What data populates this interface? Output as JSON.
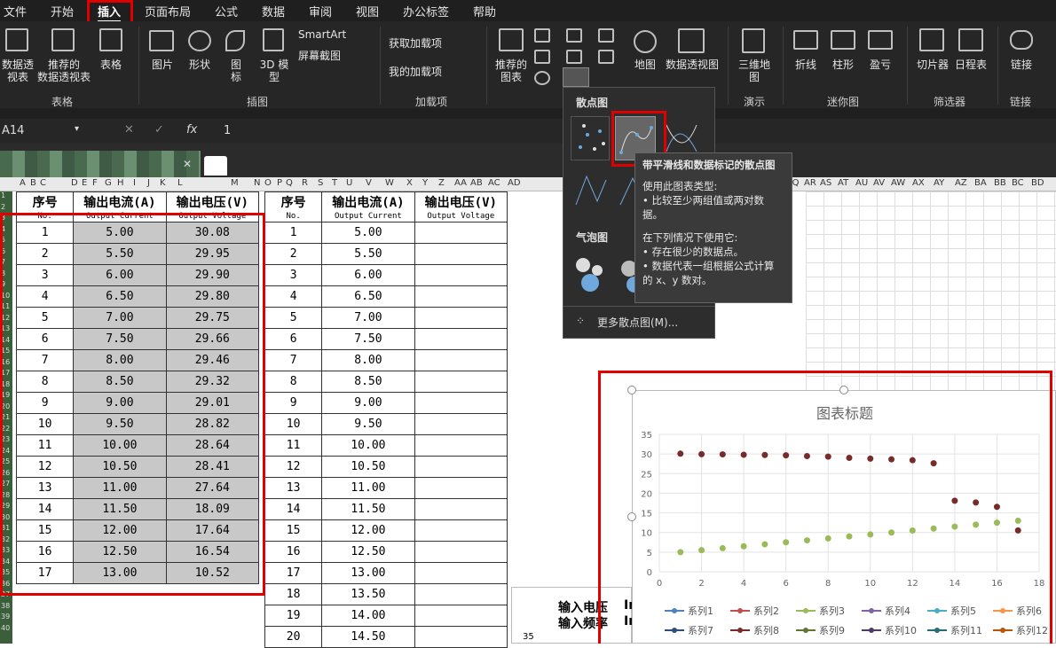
{
  "menu": {
    "items": [
      "文件",
      "开始",
      "插入",
      "页面布局",
      "公式",
      "数据",
      "审阅",
      "视图",
      "办公标签",
      "帮助"
    ],
    "active": "插入"
  },
  "ribbon": {
    "pivot": "数据透\n视表",
    "rec_pivot": "推荐的\n数据透视表",
    "table": "表格",
    "group_table": "表格",
    "picture": "图片",
    "shapes": "形状",
    "icons": "图\n标",
    "model3d": "3D 模\n型",
    "smartart": "SmartArt",
    "screenshot": "屏幕截图",
    "group_illus": "插图",
    "get_addins": "获取加载项",
    "my_addins": "我的加载项",
    "group_addins": "加载项",
    "rec_charts": "推荐的\n图表",
    "map": "地图",
    "pivot_chart": "数据透视图",
    "map3d": "三维地\n图",
    "group_tour": "演示",
    "spark_line": "折线",
    "spark_col": "柱形",
    "spark_wl": "盈亏",
    "group_spark": "迷你图",
    "slicer": "切片器",
    "timeline": "日程表",
    "group_filter": "筛选器",
    "link": "链接",
    "group_links": "链接"
  },
  "formula_bar": {
    "name_box": "A14",
    "fx": "fx",
    "value": "1"
  },
  "columns": [
    "A",
    "B",
    "C",
    "D",
    "E",
    "F",
    "G",
    "H",
    "I",
    "J",
    "K",
    "L",
    "M",
    "N",
    "O",
    "P",
    "Q",
    "R",
    "S",
    "T",
    "U",
    "V",
    "W",
    "X",
    "Y",
    "Z",
    "AA",
    "AB",
    "AC",
    "AD",
    "AQ",
    "AR",
    "AS",
    "AT",
    "AU",
    "AV",
    "AW",
    "AX",
    "AY",
    "AZ",
    "BA",
    "BB",
    "BC",
    "BD"
  ],
  "rows": [
    "1",
    "2",
    "3",
    "4",
    "5",
    "6",
    "7",
    "8",
    "9",
    "10",
    "11",
    "12",
    "13",
    "14",
    "15",
    "16",
    "17",
    "18",
    "19",
    "20",
    "21",
    "22",
    "23",
    "24",
    "25",
    "26",
    "27",
    "28",
    "29",
    "30",
    "31",
    "32",
    "33",
    "34",
    "35",
    "36",
    "37",
    "38",
    "39",
    "40"
  ],
  "table1": {
    "headers": [
      "序号",
      "输出电流(A)",
      "输出电压(V)"
    ],
    "subheaders": [
      "No.",
      "Output Current",
      "Output Voltage"
    ],
    "rows": [
      [
        "1",
        "5.00",
        "30.08"
      ],
      [
        "2",
        "5.50",
        "29.95"
      ],
      [
        "3",
        "6.00",
        "29.90"
      ],
      [
        "4",
        "6.50",
        "29.80"
      ],
      [
        "5",
        "7.00",
        "29.75"
      ],
      [
        "6",
        "7.50",
        "29.66"
      ],
      [
        "7",
        "8.00",
        "29.46"
      ],
      [
        "8",
        "8.50",
        "29.32"
      ],
      [
        "9",
        "9.00",
        "29.01"
      ],
      [
        "10",
        "9.50",
        "28.82"
      ],
      [
        "11",
        "10.00",
        "28.64"
      ],
      [
        "12",
        "10.50",
        "28.41"
      ],
      [
        "13",
        "11.00",
        "27.64"
      ],
      [
        "14",
        "11.50",
        "18.09"
      ],
      [
        "15",
        "12.00",
        "17.64"
      ],
      [
        "16",
        "12.50",
        "16.54"
      ],
      [
        "17",
        "13.00",
        "10.52"
      ]
    ]
  },
  "table2": {
    "headers": [
      "序号",
      "输出电流(A)",
      "输出电压(V)"
    ],
    "subheaders": [
      "No.",
      "Output Current",
      "Output Voltage"
    ],
    "rows": [
      [
        "1",
        "5.00"
      ],
      [
        "2",
        "5.50"
      ],
      [
        "3",
        "6.00"
      ],
      [
        "4",
        "6.50"
      ],
      [
        "5",
        "7.00"
      ],
      [
        "6",
        "7.50"
      ],
      [
        "7",
        "8.00"
      ],
      [
        "8",
        "8.50"
      ],
      [
        "9",
        "9.00"
      ],
      [
        "10",
        "9.50"
      ],
      [
        "11",
        "10.00"
      ],
      [
        "12",
        "10.50"
      ],
      [
        "13",
        "11.00"
      ],
      [
        "14",
        "11.50"
      ],
      [
        "15",
        "12.00"
      ],
      [
        "16",
        "12.50"
      ],
      [
        "17",
        "13.00"
      ],
      [
        "18",
        "13.50"
      ],
      [
        "19",
        "14.00"
      ],
      [
        "20",
        "14.50"
      ]
    ]
  },
  "dropdown": {
    "section1": "散点图",
    "section2": "气泡图",
    "more": "更多散点图(M)..."
  },
  "tooltip": {
    "title": "带平滑线和数据标记的散点图",
    "l1": "使用此图表类型:",
    "l2": "• 比较至少两组值或两对数",
    "l3": "据。",
    "l4": "在下列情况下使用它:",
    "l5": "• 存在很少的数据点。",
    "l6": "• 数据代表一组根据公式计算",
    "l7": "的 x、y 数对。"
  },
  "bg_text": {
    "a": "输入电压",
    "b": "输入频率",
    "c": "In",
    "d": "In",
    "e": "35"
  },
  "chart_data": {
    "type": "scatter",
    "title": "图表标题",
    "xlim": [
      0,
      18
    ],
    "ylim": [
      0,
      35
    ],
    "xticks": [
      "0",
      "2",
      "4",
      "6",
      "8",
      "10",
      "12",
      "14",
      "16",
      "18"
    ],
    "yticks": [
      "0",
      "5",
      "10",
      "15",
      "20",
      "25",
      "30",
      "35"
    ],
    "series": [
      {
        "name": "系列3",
        "color": "#9bbb59",
        "x": [
          1,
          2,
          3,
          4,
          5,
          6,
          7,
          8,
          9,
          10,
          11,
          12,
          13,
          14,
          15,
          16,
          17
        ],
        "y": [
          5.0,
          5.5,
          6.0,
          6.5,
          7.0,
          7.5,
          8.0,
          8.5,
          9.0,
          9.5,
          10.0,
          10.5,
          11.0,
          11.5,
          12.0,
          12.5,
          13.0
        ]
      },
      {
        "name": "系列8",
        "color": "#772c2a",
        "x": [
          1,
          2,
          3,
          4,
          5,
          6,
          7,
          8,
          9,
          10,
          11,
          12,
          13,
          14,
          15,
          16,
          17
        ],
        "y": [
          30.08,
          29.95,
          29.9,
          29.8,
          29.75,
          29.66,
          29.46,
          29.32,
          29.01,
          28.82,
          28.64,
          28.41,
          27.64,
          18.09,
          17.64,
          16.54,
          10.52
        ]
      }
    ],
    "legend": [
      {
        "name": "系列1",
        "color": "#4f81bd"
      },
      {
        "name": "系列2",
        "color": "#c0504d"
      },
      {
        "name": "系列3",
        "color": "#9bbb59"
      },
      {
        "name": "系列4",
        "color": "#8064a2"
      },
      {
        "name": "系列5",
        "color": "#4bacc6"
      },
      {
        "name": "系列6",
        "color": "#f79646"
      },
      {
        "name": "系列7",
        "color": "#2c4d75"
      },
      {
        "name": "系列8",
        "color": "#772c2a"
      },
      {
        "name": "系列9",
        "color": "#5f7530"
      },
      {
        "name": "系列10",
        "color": "#4d3b62"
      },
      {
        "name": "系列11",
        "color": "#276a7c"
      },
      {
        "name": "系列12",
        "color": "#b65708"
      }
    ],
    "legend_position": "bottom",
    "grid": true
  },
  "colors": {
    "accent_red": "#e00000",
    "ribbon_bg": "#262626",
    "selection_green": "#217346"
  }
}
